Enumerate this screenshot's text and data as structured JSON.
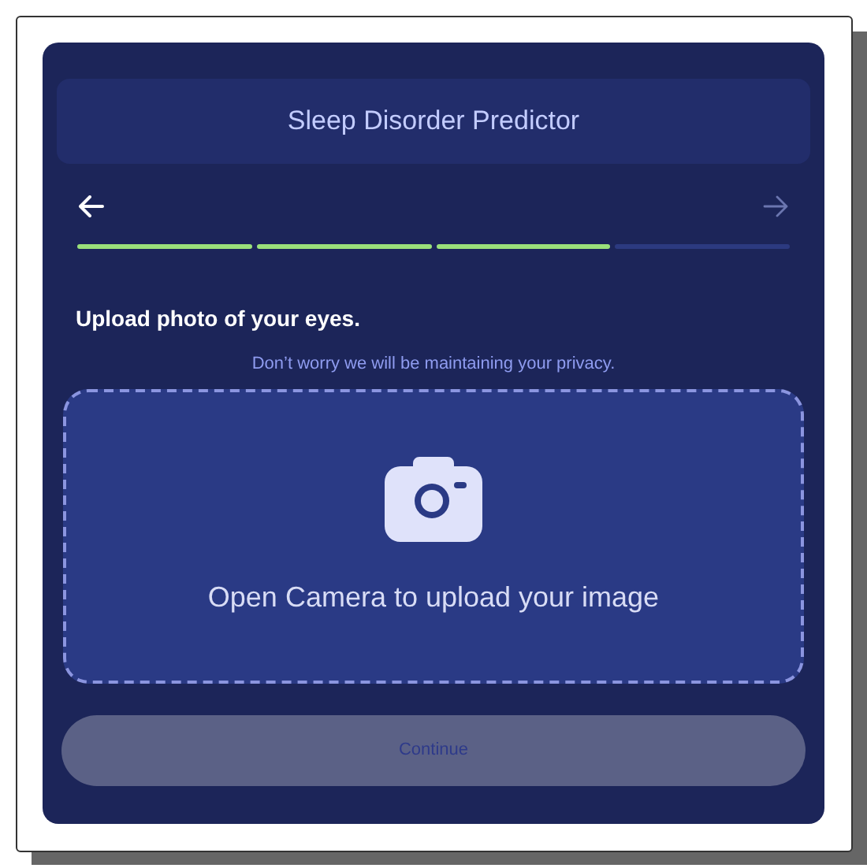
{
  "header": {
    "title": "Sleep Disorder Predictor"
  },
  "nav": {
    "back_disabled": false,
    "next_disabled": true
  },
  "steps": [
    {
      "done": true
    },
    {
      "done": true
    },
    {
      "done": true
    },
    {
      "done": false
    }
  ],
  "heading": "Upload photo of your eyes.",
  "note": "Don’t worry we will be maintaining your privacy.",
  "upload": {
    "label": "Open Camera to upload your image"
  },
  "continue_button": {
    "label": "Continue",
    "disabled": true
  }
}
